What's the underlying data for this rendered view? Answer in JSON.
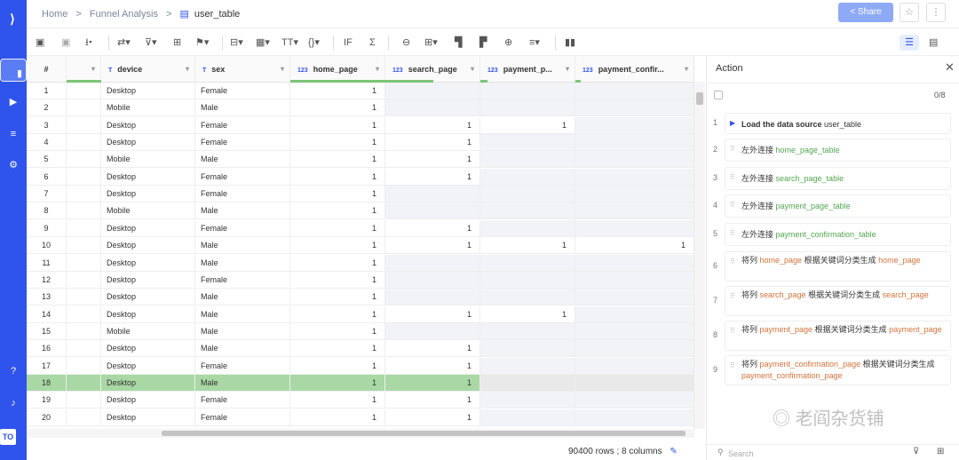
{
  "sidebar": {
    "logo": "⟩",
    "items": [
      "folder-icon",
      "play-icon",
      "layers-icon",
      "gear-icon",
      "help-icon",
      "bell-icon"
    ],
    "badge": "TO"
  },
  "breadcrumb": {
    "home": "Home",
    "sep": ">",
    "parent": "Funnel Analysis",
    "current": "user_table"
  },
  "header": {
    "share": "Share"
  },
  "grid": {
    "columns": [
      {
        "type": "",
        "label": "#"
      },
      {
        "type": "",
        "label": ""
      },
      {
        "type": "T",
        "label": "device"
      },
      {
        "type": "T",
        "label": "sex"
      },
      {
        "type": "123",
        "label": "home_page"
      },
      {
        "type": "123",
        "label": "search_page"
      },
      {
        "type": "123",
        "label": "payment_p..."
      },
      {
        "type": "123",
        "label": "payment_confir..."
      }
    ],
    "rows": [
      [
        "1",
        "Desktop",
        "Female",
        "1",
        "",
        "",
        ""
      ],
      [
        "2",
        "Mobile",
        "Male",
        "1",
        "",
        "",
        ""
      ],
      [
        "3",
        "Desktop",
        "Female",
        "1",
        "1",
        "1",
        ""
      ],
      [
        "4",
        "Desktop",
        "Female",
        "1",
        "1",
        "",
        ""
      ],
      [
        "5",
        "Mobile",
        "Male",
        "1",
        "1",
        "",
        ""
      ],
      [
        "6",
        "Desktop",
        "Female",
        "1",
        "1",
        "",
        ""
      ],
      [
        "7",
        "Desktop",
        "Female",
        "1",
        "",
        "",
        ""
      ],
      [
        "8",
        "Mobile",
        "Male",
        "1",
        "",
        "",
        ""
      ],
      [
        "9",
        "Desktop",
        "Female",
        "1",
        "1",
        "",
        ""
      ],
      [
        "10",
        "Desktop",
        "Male",
        "1",
        "1",
        "1",
        "1"
      ],
      [
        "11",
        "Desktop",
        "Male",
        "1",
        "",
        "",
        ""
      ],
      [
        "12",
        "Desktop",
        "Female",
        "1",
        "",
        "",
        ""
      ],
      [
        "13",
        "Desktop",
        "Male",
        "1",
        "",
        "",
        ""
      ],
      [
        "14",
        "Desktop",
        "Male",
        "1",
        "1",
        "1",
        ""
      ],
      [
        "15",
        "Mobile",
        "Male",
        "1",
        "",
        "",
        ""
      ],
      [
        "16",
        "Desktop",
        "Male",
        "1",
        "1",
        "",
        ""
      ],
      [
        "17",
        "Desktop",
        "Female",
        "1",
        "1",
        "",
        ""
      ],
      [
        "18",
        "Desktop",
        "Male",
        "1",
        "1",
        "",
        ""
      ],
      [
        "19",
        "Desktop",
        "Female",
        "1",
        "1",
        "",
        ""
      ],
      [
        "20",
        "Desktop",
        "Female",
        "1",
        "1",
        "",
        ""
      ]
    ],
    "selected_row": "18",
    "footer": "90400 rows ; 8 columns"
  },
  "panel": {
    "title": "Action",
    "count": "0/8",
    "steps": [
      {
        "n": "1",
        "parts": [
          [
            "b",
            "Load the data source "
          ],
          [
            "k",
            "user_table"
          ]
        ]
      },
      {
        "n": "2",
        "parts": [
          [
            "k",
            "左外连接 "
          ],
          [
            "g",
            "home_page_table"
          ]
        ]
      },
      {
        "n": "3",
        "parts": [
          [
            "k",
            "左外连接 "
          ],
          [
            "g",
            "search_page_table"
          ]
        ]
      },
      {
        "n": "4",
        "parts": [
          [
            "k",
            "左外连接 "
          ],
          [
            "g",
            "payment_page_table"
          ]
        ]
      },
      {
        "n": "5",
        "parts": [
          [
            "k",
            "左外连接 "
          ],
          [
            "g",
            "payment_confirmation_table"
          ]
        ]
      },
      {
        "n": "6",
        "parts": [
          [
            "k",
            "将列 "
          ],
          [
            "o",
            "home_page"
          ],
          [
            "k",
            " 根据关键词分类生成 "
          ],
          [
            "o",
            "home_page"
          ]
        ]
      },
      {
        "n": "7",
        "parts": [
          [
            "k",
            "将列 "
          ],
          [
            "o",
            "search_page"
          ],
          [
            "k",
            " 根据关键词分类生成 "
          ],
          [
            "o",
            "search_page"
          ]
        ]
      },
      {
        "n": "8",
        "parts": [
          [
            "k",
            "将列 "
          ],
          [
            "o",
            "payment_page"
          ],
          [
            "k",
            " 根据关键词分类生成 "
          ],
          [
            "o",
            "payment_page"
          ]
        ]
      },
      {
        "n": "9",
        "parts": [
          [
            "k",
            "将列 "
          ],
          [
            "o",
            "payment_confirmation_page"
          ],
          [
            "k",
            " 根据关键词分类生成 "
          ],
          [
            "o",
            "payment_confirmation_page"
          ]
        ]
      }
    ],
    "search_placeholder": "Search"
  },
  "watermark": "老阎杂货铺"
}
